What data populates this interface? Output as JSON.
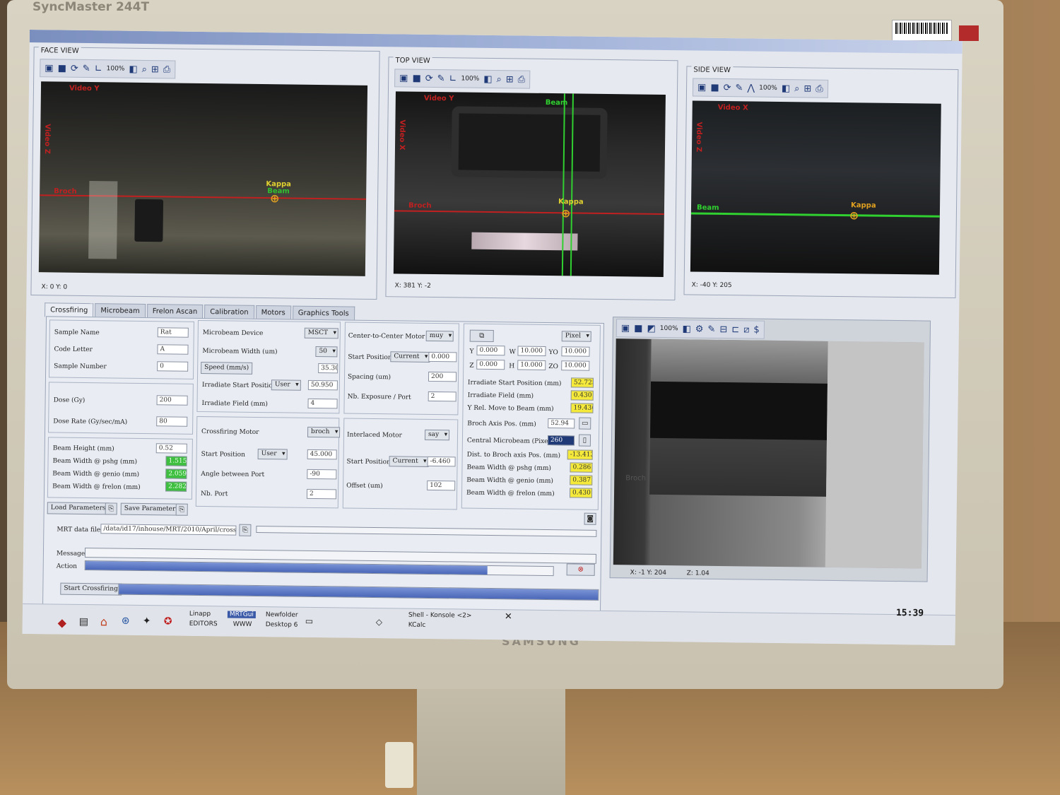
{
  "monitor": {
    "model": "SyncMaster 244T",
    "brand": "SAMSUNG"
  },
  "face_view": {
    "title": "FACE VIEW",
    "zoom": "100%",
    "video_y": "Video Y",
    "video_z": "Video Z",
    "beam_label": "Beam",
    "kappa_label": "Kappa",
    "broch_label": "Broch",
    "coords": "X: 0  Y: 0"
  },
  "top_view": {
    "title": "TOP VIEW",
    "zoom": "100%",
    "video_y": "Video Y",
    "video_x": "Video X",
    "beam_label": "Beam",
    "kappa_label": "Kappa",
    "broch_label": "Broch",
    "coords": "X: 381  Y: -2"
  },
  "side_view": {
    "title": "SIDE VIEW",
    "zoom": "100%",
    "video_x": "Video X",
    "video_z": "Video Z",
    "beam_label": "Beam",
    "kappa_label": "Kappa",
    "coords": "X: -40  Y: 205"
  },
  "tabs": [
    "Crossfiring",
    "Microbeam",
    "Frelon Ascan",
    "Calibration",
    "Motors",
    "Graphics Tools"
  ],
  "sample": {
    "name_label": "Sample Name",
    "name": "Rat",
    "code_label": "Code Letter",
    "code": "A",
    "number_label": "Sample Number",
    "number": "0"
  },
  "dose": {
    "dose_label": "Dose (Gy)",
    "dose": "200",
    "rate_label": "Dose Rate (Gy/sec/mA)",
    "rate": "80"
  },
  "beam": {
    "height_label": "Beam Height (mm)",
    "height": "0.52",
    "w_pshg_label": "Beam Width @ pshg (mm)",
    "w_pshg": "1.515",
    "w_genio_label": "Beam Width @ genio (mm)",
    "w_genio": "2.059",
    "w_frelon_label": "Beam Width @ frelon (mm)",
    "w_frelon": "2.282"
  },
  "microbeam": {
    "device_label": "Microbeam Device",
    "device": "MSCT",
    "width_label": "Microbeam Width (um)",
    "width": "50",
    "speed_btn": "Speed (mm/s)",
    "speed": "35.30",
    "irr_start_label": "Irradiate Start Position",
    "irr_start_mode": "User",
    "irr_start": "50.950",
    "irr_field_label": "Irradiate Field (mm)",
    "irr_field": "4"
  },
  "crossfiring": {
    "motor_label": "Crossfiring Motor",
    "motor": "broch",
    "start_label": "Start Position",
    "start_mode": "User",
    "start": "45.000",
    "angle_label": "Angle between Port",
    "angle": "-90",
    "nbport_label": "Nb. Port",
    "nbport": "2"
  },
  "center": {
    "motor_label": "Center-to-Center Motor",
    "motor": "muy",
    "start_label": "Start Position",
    "start_mode": "Current",
    "start": "0.000",
    "spacing_label": "Spacing (um)",
    "spacing": "200",
    "nbexp_label": "Nb. Exposure / Port",
    "nbexp": "2"
  },
  "interlaced": {
    "motor_label": "Interlaced Motor",
    "motor": "say",
    "start_label": "Start Position",
    "start_mode": "Current",
    "start": "-6.460",
    "offset_label": "Offset (um)",
    "offset": "102"
  },
  "roi": {
    "unit": "Pixel",
    "y_label": "Y",
    "y": "0.000",
    "w_label": "W",
    "w": "10.000",
    "yo_label": "YO",
    "yo": "10.000",
    "z_label": "Z",
    "z": "0.000",
    "h_label": "H",
    "h": "10.000",
    "zo_label": "ZO",
    "zo": "10.000"
  },
  "results": {
    "irr_start_label": "Irradiate Start Position (mm)",
    "irr_start": "52.725",
    "irr_field_label": "Irradiate Field (mm)",
    "irr_field": "0.430",
    "yrel_label": "Y Rel. Move to Beam (mm)",
    "yrel": "19.436",
    "broch_axis_label": "Broch Axis Pos. (mm)",
    "broch_axis": "52.94",
    "central_label": "Central Microbeam (Pixel)",
    "central": "260",
    "dist_label": "Dist. to Broch axis Pos. (mm)",
    "dist": "-13.413",
    "w_pshg_label": "Beam Width @ pshg (mm)",
    "w_pshg": "0.286",
    "w_genio_label": "Beam Width @ genio (mm)",
    "w_genio": "0.387",
    "w_frelon_label": "Beam Width @ frelon (mm)",
    "w_frelon": "0.430"
  },
  "params": {
    "load": "Load Parameters",
    "save": "Save Parameters"
  },
  "mrt": {
    "label": "MRT data file",
    "path": "/data/id17/inhouse/MRT/2010/April/crossbi"
  },
  "status": {
    "message_label": "Message",
    "action_label": "Action",
    "start_button": "Start Crossfiring",
    "action_progress": 0.86,
    "start_progress": 1.0
  },
  "frelon": {
    "zoom": "100%",
    "broch_label": "Broch",
    "coords": "X: -1  Y: 204",
    "z": "Z: 1.04"
  },
  "taskbar": {
    "d1_top": "Linapp",
    "d1_bottom": "EDITORS",
    "d2_top": "MRTGui",
    "d2_bottom": "WWW",
    "d3_top": "Newfolder",
    "d3_bottom": "Desktop 6",
    "task1": "Shell - Konsole <2>",
    "task2": "KCalc",
    "clock": "15:39"
  }
}
